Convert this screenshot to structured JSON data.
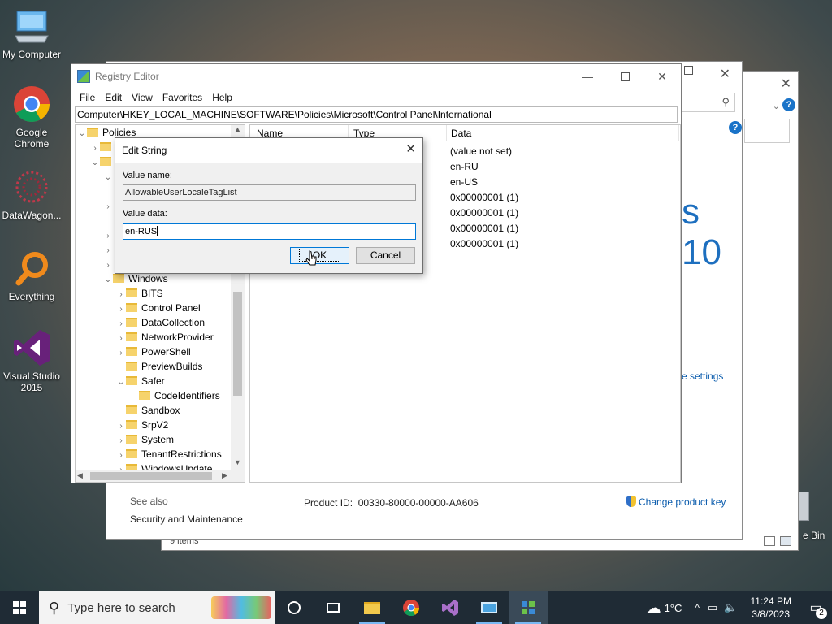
{
  "desktop": {
    "icons": [
      {
        "label": "My Computer",
        "icon": "computer-icon"
      },
      {
        "label": "Google Chrome",
        "icon": "chrome-icon"
      },
      {
        "label": "DataWagon...",
        "icon": "datawagon-icon"
      },
      {
        "label": "Everything",
        "icon": "everything-search-icon"
      },
      {
        "label": "Visual Studio 2015",
        "icon": "visual-studio-icon"
      }
    ],
    "recycle_bin_label": "e Bin"
  },
  "background_window": {
    "win10_text": "s 10",
    "settings_link": "e settings",
    "see_also": "See also",
    "security_link": "Security and Maintenance",
    "product_id": "Product ID:  00330-80000-00000-AA606",
    "change_key": "Change product key",
    "items_count": "9 items"
  },
  "registry": {
    "title": "Registry Editor",
    "menu": [
      "File",
      "Edit",
      "View",
      "Favorites",
      "Help"
    ],
    "address": "Computer\\HKEY_LOCAL_MACHINE\\SOFTWARE\\Policies\\Microsoft\\Control Panel\\International",
    "columns": {
      "name": "Name",
      "type": "Type",
      "data": "Data"
    },
    "data_values": [
      "(value not set)",
      "en-RU",
      "en-US",
      "0x00000001 (1)",
      "0x00000001 (1)",
      "0x00000001 (1)",
      "0x00000001 (1)"
    ],
    "tree": {
      "policies": "Policies",
      "windows": "Windows",
      "children": [
        "BITS",
        "Control Panel",
        "DataCollection",
        "NetworkProvider",
        "PowerShell",
        "PreviewBuilds",
        "Safer",
        "CodeIdentifiers",
        "Sandbox",
        "SrpV2",
        "System",
        "TenantRestrictions",
        "WindowsUpdate"
      ]
    }
  },
  "dialog": {
    "title": "Edit String",
    "value_name_label": "Value name:",
    "value_name": "AllowableUserLocaleTagList",
    "value_data_label": "Value data:",
    "value_data": "en-RUS",
    "ok": "OK",
    "cancel": "Cancel"
  },
  "taskbar": {
    "search_placeholder": "Type here to search",
    "weather": "1°C",
    "time": "11:24 PM",
    "date": "3/8/2023",
    "notifications": "2"
  }
}
